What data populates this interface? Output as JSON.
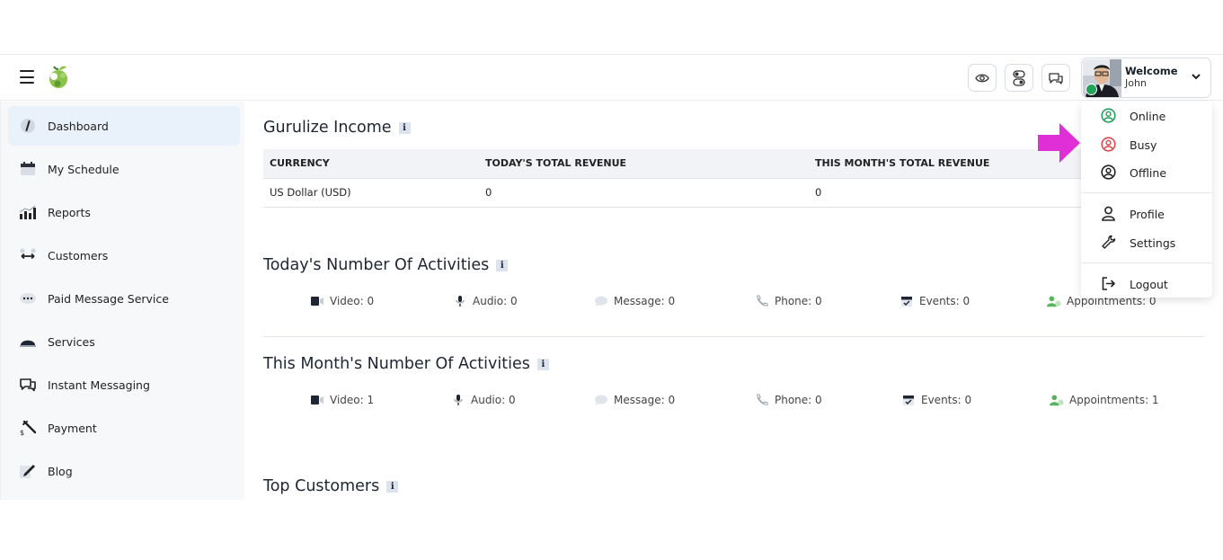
{
  "header": {
    "welcome": "Welcome",
    "user_name": "John",
    "icons": [
      "menu-icon",
      "logo",
      "eye-icon",
      "toggle-icon",
      "chat-icon",
      "chevron-down-icon"
    ],
    "status_color": "#22a35a"
  },
  "sidebar": {
    "items": [
      {
        "label": "Dashboard",
        "icon": "dashboard-icon",
        "active": true
      },
      {
        "label": "My Schedule",
        "icon": "calendar-icon"
      },
      {
        "label": "Reports",
        "icon": "bar-chart-icon"
      },
      {
        "label": "Customers",
        "icon": "customers-icon"
      },
      {
        "label": "Paid Message Service",
        "icon": "message-dots-icon"
      },
      {
        "label": "Services",
        "icon": "services-icon"
      },
      {
        "label": "Instant Messaging",
        "icon": "chat-icon"
      },
      {
        "label": "Payment",
        "icon": "payment-icon"
      },
      {
        "label": "Blog",
        "icon": "blog-edit-icon"
      }
    ]
  },
  "income": {
    "title": "Gurulize Income",
    "info": "i",
    "columns": [
      "CURRENCY",
      "TODAY'S TOTAL REVENUE",
      "THIS MONTH'S TOTAL REVENUE"
    ],
    "rows": [
      [
        "US Dollar (USD)",
        "0",
        "0"
      ]
    ]
  },
  "today": {
    "title": "Today's Number Of Activities",
    "info": "i",
    "items": [
      {
        "label": "Video: 0",
        "icon": "video-icon"
      },
      {
        "label": "Audio: 0",
        "icon": "microphone-icon"
      },
      {
        "label": "Message: 0",
        "icon": "message-icon"
      },
      {
        "label": "Phone: 0",
        "icon": "phone-icon"
      },
      {
        "label": "Events: 0",
        "icon": "calendar-check-icon"
      },
      {
        "label": "Appointments: 0",
        "icon": "appointment-user-icon"
      }
    ]
  },
  "month": {
    "title": "This Month's Number Of Activities",
    "info": "i",
    "items": [
      {
        "label": "Video: 1",
        "icon": "video-icon"
      },
      {
        "label": "Audio: 0",
        "icon": "microphone-icon"
      },
      {
        "label": "Message: 0",
        "icon": "message-icon"
      },
      {
        "label": "Phone: 0",
        "icon": "phone-icon"
      },
      {
        "label": "Events: 0",
        "icon": "calendar-check-icon"
      },
      {
        "label": "Appointments: 1",
        "icon": "appointment-user-icon"
      }
    ]
  },
  "customers": {
    "title": "Top Customers",
    "info": "i"
  },
  "dropdown": {
    "status": [
      {
        "label": "Online",
        "icon": "user-circle-icon",
        "color": "#22a35a"
      },
      {
        "label": "Busy",
        "icon": "user-circle-icon",
        "color": "#e0464f"
      },
      {
        "label": "Offline",
        "icon": "user-circle-icon",
        "color": "#222222"
      }
    ],
    "account": [
      {
        "label": "Profile",
        "icon": "user-icon"
      },
      {
        "label": "Settings",
        "icon": "wrench-icon"
      }
    ],
    "logout": {
      "label": "Logout",
      "icon": "logout-icon"
    }
  },
  "annotation": {
    "arrow_color": "#e02fd6"
  }
}
